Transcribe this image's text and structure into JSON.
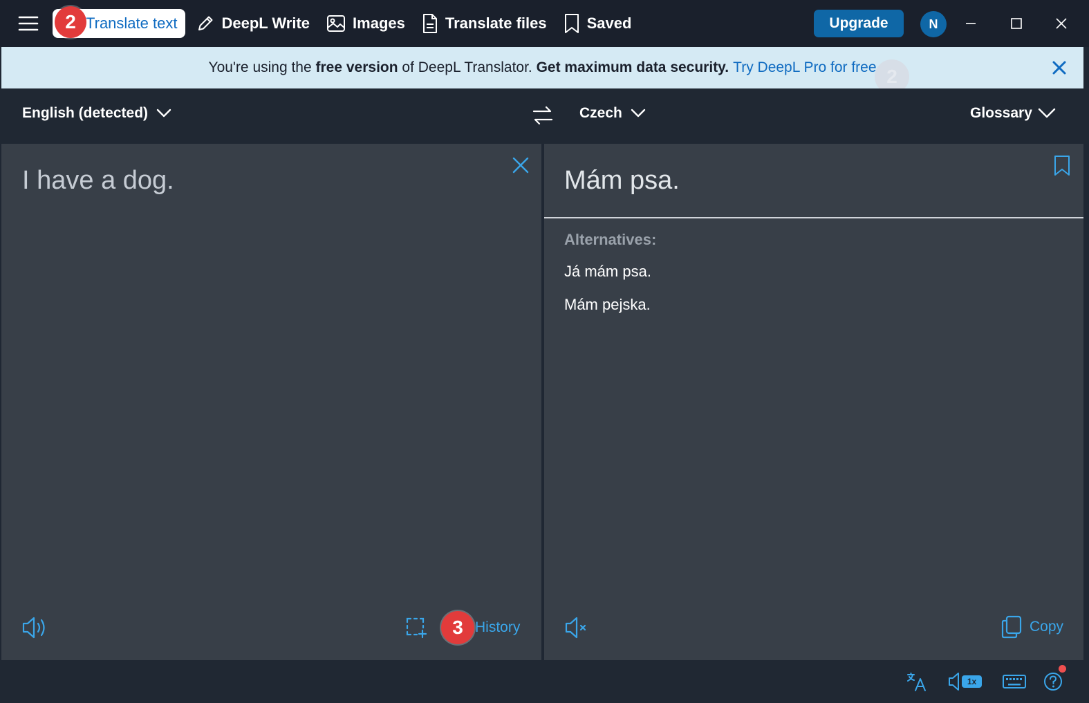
{
  "nav": {
    "tabs": [
      {
        "label": "Translate text",
        "active": true
      },
      {
        "label": "DeepL Write"
      },
      {
        "label": "Images"
      },
      {
        "label": "Translate files"
      },
      {
        "label": "Saved"
      }
    ],
    "upgrade_label": "Upgrade",
    "avatar_initial": "N"
  },
  "banner": {
    "text_1": "You're using the ",
    "bold_1": "free version",
    "text_2": " of DeepL Translator. ",
    "bold_2": "Get maximum data security.",
    "link": "Try DeepL Pro for free"
  },
  "languages": {
    "source": "English (detected)",
    "target": "Czech",
    "glossary": "Glossary"
  },
  "source": {
    "text": "I have a dog.",
    "history_label": "History"
  },
  "target": {
    "text": "Mám psa.",
    "alternatives_title": "Alternatives:",
    "alternatives": [
      "Já mám psa.",
      "Mám pejska."
    ],
    "copy_label": "Copy"
  },
  "status": {
    "speed_label": "1x"
  },
  "annotations": {
    "badge_nav": "2",
    "badge_ghost": "2",
    "badge_history": "3"
  },
  "colors": {
    "accent": "#0f67a6",
    "link": "#3aa6ea",
    "badge": "#e23b3b",
    "banner_bg": "#d5eaf4"
  }
}
